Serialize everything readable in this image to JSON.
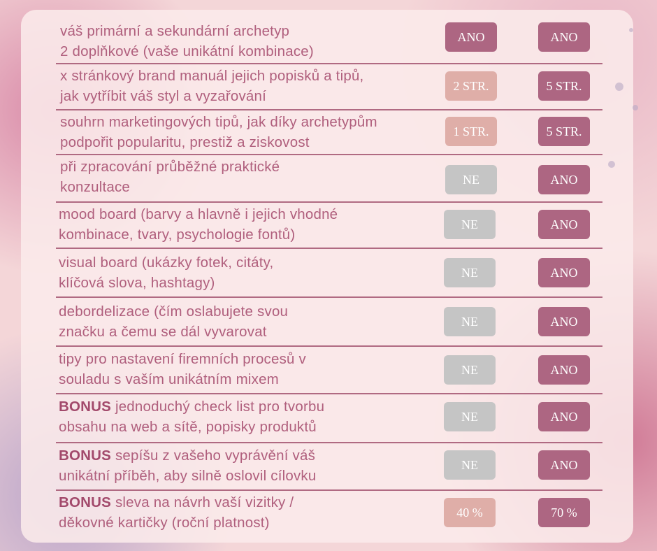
{
  "rows": [
    {
      "line1": "váš primární a sekundární archetyp",
      "line2": "2 doplňkové (vaše unikátní kombinace)",
      "bonus": "",
      "col1": "ANO",
      "col2": "ANO",
      "col1_style": "dark",
      "col2_style": "dark"
    },
    {
      "line1": "x stránkový brand manuál jejich popisků a tipů,",
      "line2": "jak vytříbit váš styl a vyzařování",
      "bonus": "",
      "col1": "2 STR.",
      "col2": "5 STR.",
      "col1_style": "peach",
      "col2_style": "dark"
    },
    {
      "line1": "souhrn marketingových tipů, jak díky archetypům",
      "line2": "podpořit popularitu, prestiž a ziskovost",
      "bonus": "",
      "col1": "1 STR.",
      "col2": "5 STR.",
      "col1_style": "peach",
      "col2_style": "dark"
    },
    {
      "line1": "při zpracování průběžné praktické",
      "line2": "konzultace",
      "bonus": "",
      "col1": "NE",
      "col2": "ANO",
      "col1_style": "gray",
      "col2_style": "dark"
    },
    {
      "line1": "mood board (barvy a hlavně i jejich vhodné",
      "line2": "kombinace, tvary, psychologie fontů)",
      "bonus": "",
      "col1": "NE",
      "col2": "ANO",
      "col1_style": "gray",
      "col2_style": "dark"
    },
    {
      "line1": "visual board (ukázky fotek, citáty,",
      "line2": "klíčová slova, hashtagy)",
      "bonus": "",
      "col1": "NE",
      "col2": "ANO",
      "col1_style": "gray",
      "col2_style": "dark"
    },
    {
      "line1": "debordelizace (čím oslabujete svou",
      "line2": "značku a čemu se dál vyvarovat",
      "bonus": "",
      "col1": "NE",
      "col2": "ANO",
      "col1_style": "gray",
      "col2_style": "dark"
    },
    {
      "line1": "tipy pro nastavení firemních procesů v",
      "line2": "souladu s vaším unikátním mixem",
      "bonus": "",
      "col1": "NE",
      "col2": "ANO",
      "col1_style": "gray",
      "col2_style": "dark"
    },
    {
      "line1": " jednoduchý check list pro tvorbu",
      "line2": "obsahu na web a sítě, popisky produktů",
      "bonus": "BONUS",
      "col1": "NE",
      "col2": "ANO",
      "col1_style": "gray",
      "col2_style": "dark"
    },
    {
      "line1": " sepíšu z vašeho vyprávění váš",
      "line2": "unikátní příběh, aby silně oslovil cílovku",
      "bonus": "BONUS",
      "col1": "NE",
      "col2": "ANO",
      "col1_style": "gray",
      "col2_style": "dark"
    },
    {
      "line1": " sleva na návrh vaší vizitky /",
      "line2": "děkovné kartičky (roční platnost)",
      "bonus": "BONUS",
      "col1": "40 %",
      "col2": "70 %",
      "col1_style": "peach",
      "col2_style": "dark"
    }
  ]
}
